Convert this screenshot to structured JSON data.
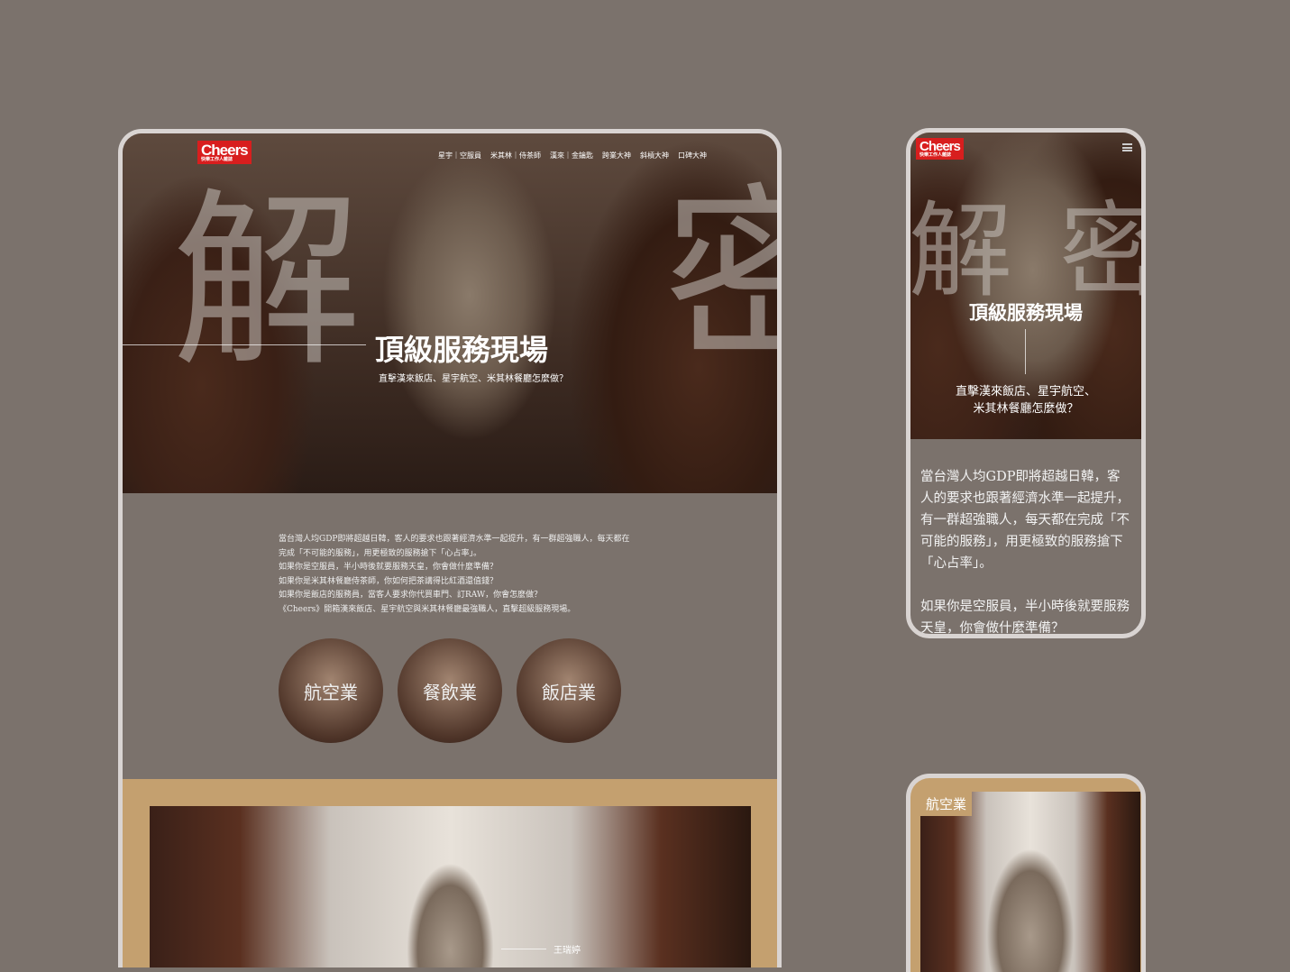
{
  "logo": {
    "name": "Cheers",
    "tagline": "快樂工作人雜誌"
  },
  "nav": [
    "星宇｜空服員",
    "米其林｜侍茶師",
    "漢來｜金鑰匙",
    "跨業大神",
    "斜槓大神",
    "口碑大神"
  ],
  "hero": {
    "char1": "解",
    "char2": "密",
    "title": "頂級服務現場",
    "subtitle": "直擊漢來飯店、星宇航空、米其林餐廳怎麼做？",
    "subtitle_mobile_1": "直擊漢來飯店、星宇航空、",
    "subtitle_mobile_2": "米其林餐廳怎麼做？"
  },
  "intro": [
    "當台灣人均GDP即將超越日韓，客人的要求也跟著經濟水準一起提升，有一群超強職人，每天都在完成「不可能的服務」，用更極致的服務搶下「心占率」。",
    "如果你是空服員，半小時後就要服務天皇，你會做什麼準備？",
    "如果你是米其林餐廳侍茶師，你如何把茶講得比紅酒還值錢？",
    "如果你是飯店的服務員，當客人要求你代買車門、訂RAW，你會怎麼做？",
    "《Cheers》開箱漢來飯店、星宇航空與米其林餐廳最強職人，直擊超級服務現場。"
  ],
  "categories": [
    "航空業",
    "餐飲業",
    "飯店業"
  ],
  "feature": {
    "person": "王瑞婷"
  },
  "mobile": {
    "intro": "當台灣人均GDP即將超越日韓，客人的要求也跟著經濟水準一起提升，有一群超強職人，每天都在完成「不可能的服務」，用更極致的服務搶下「心占率」。",
    "intro2": "如果你是空服員，半小時後就要服務天皇，你會做什麼準備？",
    "section_label": "航空業"
  }
}
